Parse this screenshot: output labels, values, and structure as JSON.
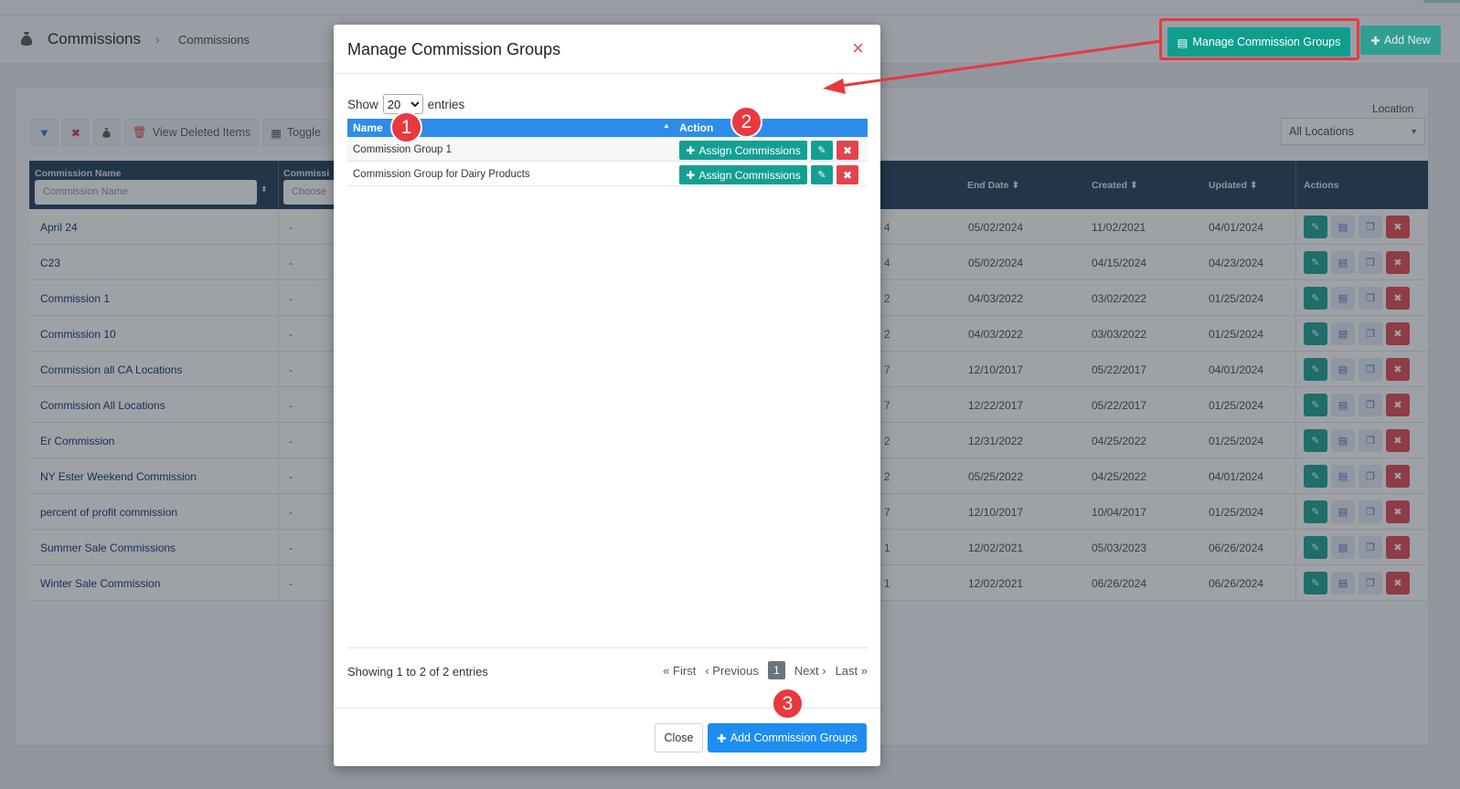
{
  "header": {
    "title": "Commissions",
    "breadcrumb": "Commissions",
    "manage_button": "Manage Commission Groups",
    "add_new_button": "Add New"
  },
  "toolbar": {
    "view_deleted": "View Deleted Items",
    "toggle": "Toggle"
  },
  "location": {
    "label": "Location",
    "selected": "All Locations"
  },
  "grid": {
    "columns": {
      "name": "Commission Name",
      "second": "Commissi",
      "end_date": "End Date",
      "created": "Created",
      "updated": "Updated",
      "actions": "Actions"
    },
    "filters": {
      "name_placeholder": "Commission Name",
      "choose_placeholder": "Choose"
    },
    "rows": [
      {
        "name": "April 24",
        "dash": "-",
        "frag": "4",
        "end": "05/02/2024",
        "created": "11/02/2021",
        "updated": "04/01/2024"
      },
      {
        "name": "C23",
        "dash": "-",
        "frag": "4",
        "end": "05/02/2024",
        "created": "04/15/2024",
        "updated": "04/23/2024"
      },
      {
        "name": "Commission 1",
        "dash": "-",
        "frag": "2",
        "end": "04/03/2022",
        "created": "03/02/2022",
        "updated": "01/25/2024"
      },
      {
        "name": "Commission 10",
        "dash": "-",
        "frag": "2",
        "end": "04/03/2022",
        "created": "03/03/2022",
        "updated": "01/25/2024"
      },
      {
        "name": "Commission all CA Locations",
        "dash": "-",
        "frag": "7",
        "end": "12/10/2017",
        "created": "05/22/2017",
        "updated": "04/01/2024"
      },
      {
        "name": "Commission All Locations",
        "dash": "-",
        "frag": "7",
        "end": "12/22/2017",
        "created": "05/22/2017",
        "updated": "01/25/2024"
      },
      {
        "name": "Er Commission",
        "dash": "-",
        "frag": "2",
        "end": "12/31/2022",
        "created": "04/25/2022",
        "updated": "01/25/2024"
      },
      {
        "name": "NY Ester Weekend Commission",
        "dash": "-",
        "frag": "2",
        "end": "05/25/2022",
        "created": "04/25/2022",
        "updated": "04/01/2024"
      },
      {
        "name": "percent of profit commission",
        "dash": "-",
        "frag": "7",
        "end": "12/10/2017",
        "created": "10/04/2017",
        "updated": "01/25/2024"
      },
      {
        "name": "Summer Sale Commissions",
        "dash": "-",
        "frag": "1",
        "end": "12/02/2021",
        "created": "05/03/2023",
        "updated": "06/26/2024"
      },
      {
        "name": "Winter Sale Commission",
        "dash": "-",
        "frag": "1",
        "end": "12/02/2021",
        "created": "06/26/2024",
        "updated": "06/26/2024"
      }
    ]
  },
  "modal": {
    "title": "Manage Commission Groups",
    "close_icon": "×",
    "show_label": "Show",
    "show_value": "20",
    "entries_label": "entries",
    "table_headers": {
      "name": "Name",
      "action": "Action"
    },
    "groups": [
      {
        "name": "Commission Group 1",
        "assign": "Assign Commissions"
      },
      {
        "name": "Commission Group for Dairy Products",
        "assign": "Assign Commissions"
      }
    ],
    "showing": "Showing 1 to 2 of 2 entries",
    "pager": {
      "first": "First",
      "previous": "Previous",
      "current": "1",
      "next": "Next",
      "last": "Last"
    },
    "close_button": "Close",
    "add_groups_button": "Add Commission Groups"
  },
  "annotations": {
    "badge1": "1",
    "badge2": "2",
    "badge3": "3"
  },
  "colors": {
    "teal": "#0f9e8e",
    "blue": "#1e8df0",
    "red": "#e8393f",
    "navy": "#1f3a55"
  }
}
